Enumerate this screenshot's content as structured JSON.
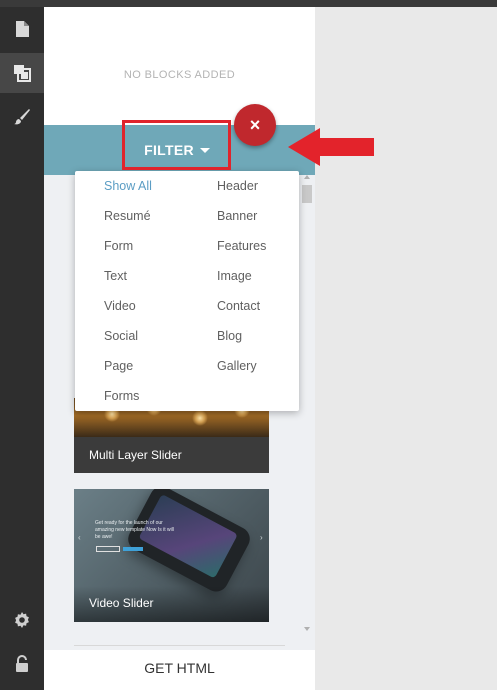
{
  "sidebar_rail": {
    "items": [
      {
        "icon": "page-icon",
        "active": false
      },
      {
        "icon": "blocks-icon",
        "active": true
      },
      {
        "icon": "brush-icon",
        "active": false
      }
    ],
    "bottom_items": [
      {
        "icon": "gear-icon"
      },
      {
        "icon": "lock-icon"
      }
    ]
  },
  "panel": {
    "empty_message": "NO BLOCKS ADDED",
    "filter_label": "FILTER",
    "close_glyph": "×",
    "get_html_label": "GET HTML"
  },
  "filter_menu": {
    "left_column": [
      "Show All",
      "Resumé",
      "Form",
      "Text",
      "Video",
      "Social",
      "Page",
      "Forms"
    ],
    "right_column": [
      "Header",
      "Banner",
      "Features",
      "Image",
      "Contact",
      "Blog",
      "Gallery"
    ],
    "selected": "Show All"
  },
  "block_cards": [
    {
      "label": "Multi Layer Slider"
    },
    {
      "label": "Video Slider",
      "preview_text": "Get ready for the launch of our amazing new template Now Is it will be awe!"
    }
  ],
  "colors": {
    "rail_bg": "#2e2e2e",
    "filter_bar": "#6fa8b8",
    "highlight": "#e0242c",
    "close_button": "#c0282d",
    "menu_active": "#5b9dc4"
  }
}
